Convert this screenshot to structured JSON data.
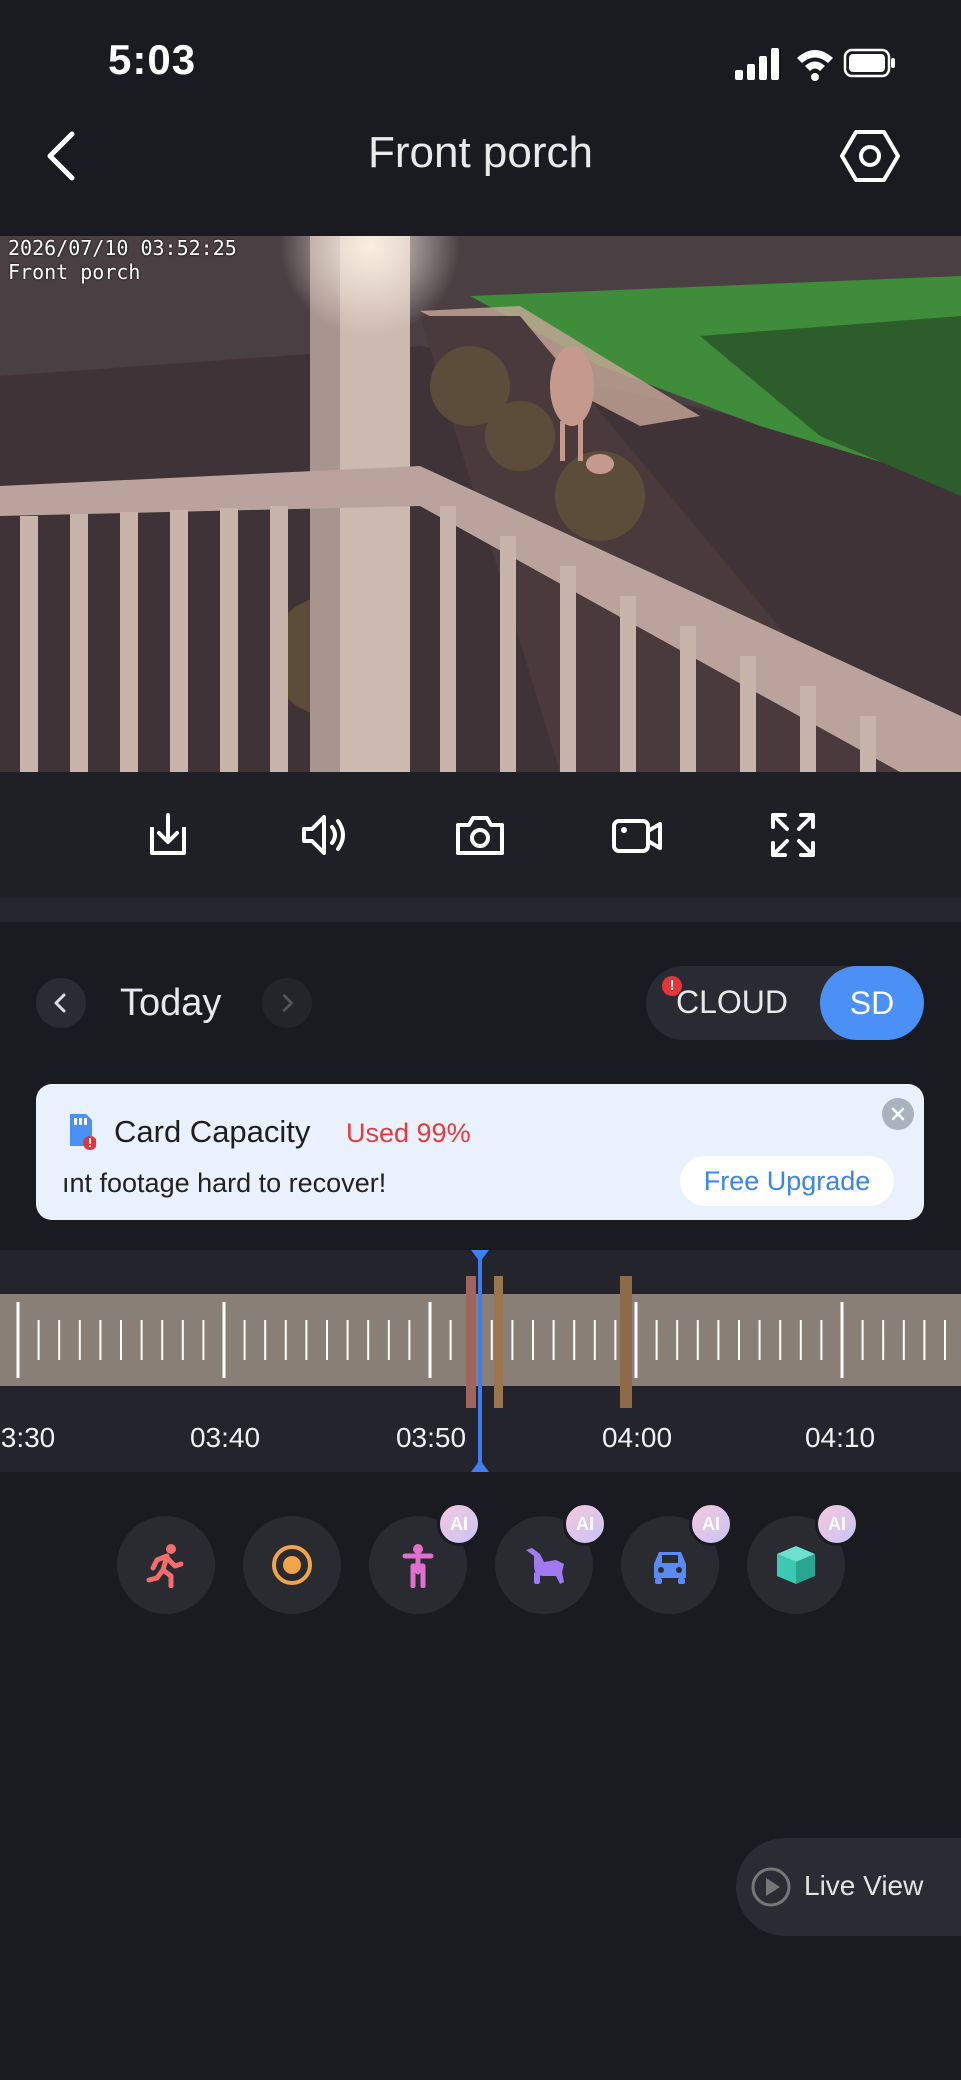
{
  "status_bar": {
    "time": "5:03"
  },
  "header": {
    "title": "Front porch"
  },
  "video": {
    "osd_timestamp": "2026/07/10 03:52:25",
    "osd_camera_name": "Front porch"
  },
  "toolbar": {
    "buttons": [
      {
        "icon": "download-icon"
      },
      {
        "icon": "speaker-icon"
      },
      {
        "icon": "snapshot-camera-icon"
      },
      {
        "icon": "record-video-icon"
      },
      {
        "icon": "fullscreen-icon"
      }
    ]
  },
  "date_nav": {
    "label": "Today"
  },
  "source_toggle": {
    "cloud_label": "CLOUD",
    "cloud_badge": "!",
    "sd_label": "SD",
    "selected": "SD"
  },
  "banner": {
    "title": "Card Capacity",
    "used": "Used 99%",
    "message": "ınt footage hard to recover!",
    "upgrade_label": "Free Upgrade"
  },
  "timeline": {
    "labels": [
      "3:30",
      "03:40",
      "03:50",
      "04:00",
      "04:10"
    ],
    "current_time": "03:52:25"
  },
  "filters": [
    {
      "icon": "motion-running-icon",
      "color": "#f06e6e",
      "ai": ""
    },
    {
      "icon": "all-events-target-icon",
      "color": "#f2a44a",
      "ai": ""
    },
    {
      "icon": "person-icon",
      "color": "#e070d0",
      "ai": "AI"
    },
    {
      "icon": "pet-icon",
      "color": "#a07af0",
      "ai": "AI"
    },
    {
      "icon": "vehicle-icon",
      "color": "#5b8af0",
      "ai": "AI"
    },
    {
      "icon": "package-icon",
      "color": "#3cc9b4",
      "ai": "AI"
    }
  ],
  "live_view": {
    "label": "Live View"
  },
  "colors": {
    "accent": "#4a90f5",
    "background": "#1a1b20",
    "warning": "#e23c3c"
  }
}
